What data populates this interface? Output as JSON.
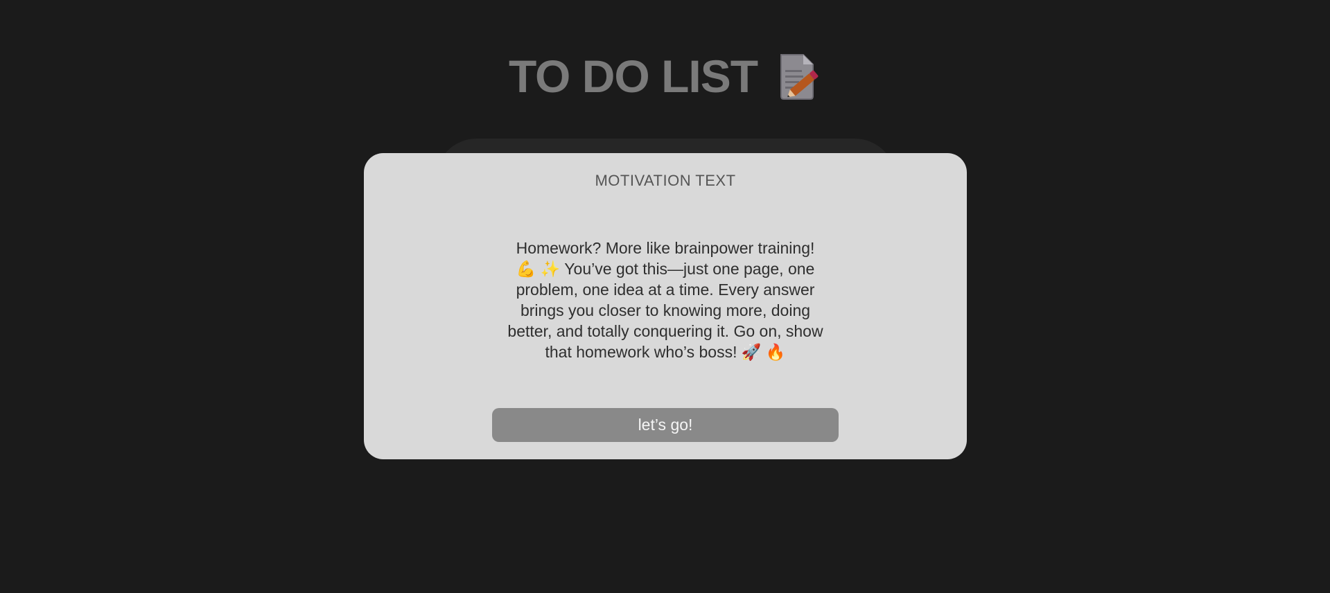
{
  "app": {
    "title": "TO DO LIST",
    "title_icon": "memo-icon"
  },
  "modal": {
    "title": "MOTIVATION TEXT",
    "message": "Homework? More like brainpower training! 💪 ✨ You’ve got this—just one page, one problem, one idea at a time. Every answer brings you closer to knowing more, doing better, and totally conquering it. Go on, show that homework who’s boss! 🚀 🔥",
    "button_label": "let’s go!"
  },
  "colors": {
    "background": "#1b1b1b",
    "title": "#7a7a7a",
    "modal_bg": "#d9d9d9",
    "button_bg": "#898989"
  }
}
